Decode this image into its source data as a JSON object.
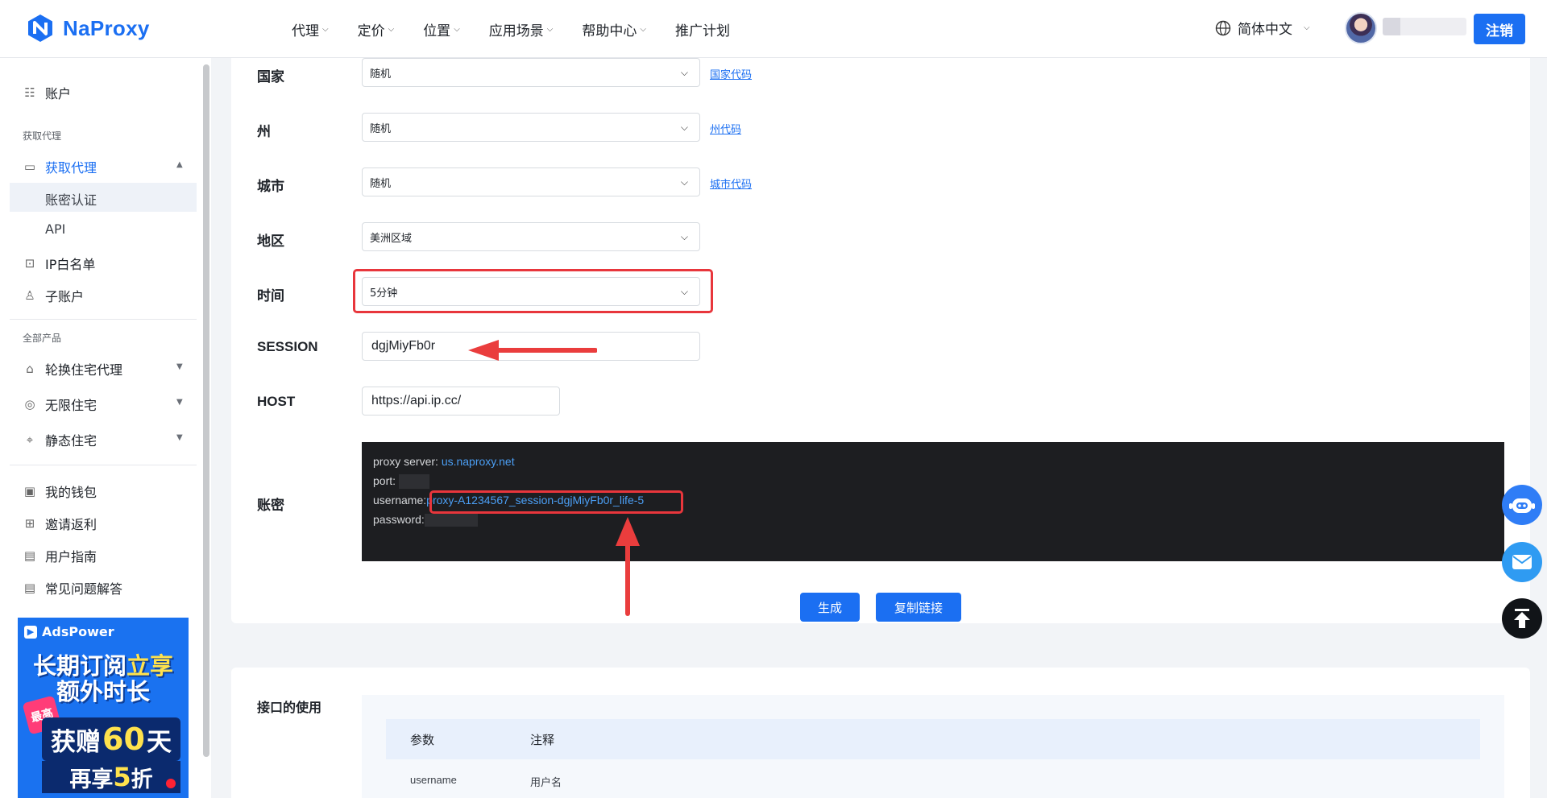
{
  "brand": {
    "name": "NaProxy",
    "color": "#1b6ff2"
  },
  "nav": {
    "items": [
      {
        "label": "代理",
        "has_dropdown": true
      },
      {
        "label": "定价",
        "has_dropdown": true
      },
      {
        "label": "位置",
        "has_dropdown": true
      },
      {
        "label": "应用场景",
        "has_dropdown": true
      },
      {
        "label": "帮助中心",
        "has_dropdown": true
      },
      {
        "label": "推广计划",
        "has_dropdown": false
      }
    ],
    "language": "简体中文",
    "logout_label": "注销"
  },
  "sidebar": {
    "account": "账户",
    "group_get_proxy": "获取代理",
    "get_proxy": "获取代理",
    "sub_auth": "账密认证",
    "sub_api": "API",
    "ip_whitelist": "IP白名单",
    "sub_accounts": "子账户",
    "group_all_products": "全部产品",
    "rotating_residential": "轮换住宅代理",
    "unlimited_residential": "无限住宅",
    "static_residential": "静态住宅",
    "wallet": "我的钱包",
    "referral": "邀请返利",
    "user_guide": "用户指南",
    "faq": "常见问题解答"
  },
  "ad": {
    "brand": "AdsPower",
    "line1_a": "长期订阅",
    "line1_b": "立享",
    "line2": "额外时长",
    "badge": "最高",
    "gift_a": "获赠",
    "gift_num": "60",
    "gift_b": "天",
    "discount_a": "再享",
    "discount_num": "5",
    "discount_b": "折"
  },
  "form": {
    "country": {
      "label": "国家",
      "value": "随机",
      "link": "国家代码"
    },
    "state": {
      "label": "州",
      "value": "随机",
      "link": "州代码"
    },
    "city": {
      "label": "城市",
      "value": "随机",
      "link": "城市代码"
    },
    "region": {
      "label": "地区",
      "value": "美洲区域"
    },
    "time": {
      "label": "时间",
      "value": "5分钟"
    },
    "session": {
      "label": "SESSION",
      "value": "dgjMiyFb0r"
    },
    "host": {
      "label": "HOST",
      "value": "https://api.ip.cc/"
    },
    "credentials_label": "账密"
  },
  "console": {
    "server_key": "proxy server:",
    "server_val": "us.naproxy.net",
    "port_key": "port:",
    "username_key": "username:",
    "username_val": "proxy-A1234567_session-dgjMiyFb0r_life-5",
    "password_key": "password:"
  },
  "buttons": {
    "generate": "生成",
    "copy_link": "复制链接"
  },
  "api_usage": {
    "title": "接口的使用",
    "headers": [
      "参数",
      "注释"
    ],
    "rows": [
      {
        "param": "username",
        "note": "用户名"
      }
    ]
  },
  "colors": {
    "accent": "#1b6ff2",
    "annotation": "#e8363c",
    "console_bg": "#1d1e21"
  }
}
